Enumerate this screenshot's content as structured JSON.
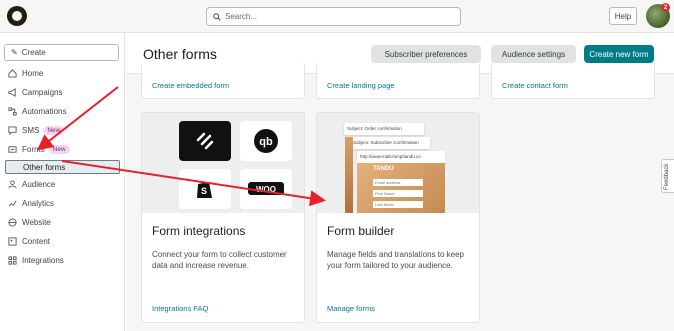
{
  "search": {
    "placeholder": "Search..."
  },
  "topbar": {
    "help_label": "Help",
    "notification_count": "2"
  },
  "sidebar": {
    "create_label": "Create",
    "items": [
      {
        "label": "Home",
        "icon": "home-icon"
      },
      {
        "label": "Campaigns",
        "icon": "megaphone-icon"
      },
      {
        "label": "Automations",
        "icon": "automation-icon"
      },
      {
        "label": "SMS",
        "icon": "sms-icon",
        "tag": "New"
      },
      {
        "label": "Forms",
        "icon": "forms-icon",
        "tag": "New"
      },
      {
        "label": "Audience",
        "icon": "audience-icon"
      },
      {
        "label": "Analytics",
        "icon": "analytics-icon"
      },
      {
        "label": "Website",
        "icon": "website-icon"
      },
      {
        "label": "Content",
        "icon": "content-icon"
      },
      {
        "label": "Integrations",
        "icon": "integrations-icon"
      }
    ],
    "sub_item": "Other forms"
  },
  "header": {
    "title": "Other forms",
    "subscriber_preferences": "Subscriber preferences",
    "audience_settings": "Audience settings",
    "create_new_form": "Create new form"
  },
  "top_links": [
    "Create embedded form",
    "Create landing page",
    "Create contact form"
  ],
  "cards": [
    {
      "title": "Form integrations",
      "description": "Connect your form to collect customer data and increase revenue.",
      "link": "Integrations FAQ"
    },
    {
      "title": "Form builder",
      "description": "Manage fields and translations to keep your form tailored to your audience.",
      "link": "Manage forms"
    }
  ],
  "form_preview": {
    "subject1": "Subject: Order confirmation",
    "subject2": "Subject: Subscriber Confirmation",
    "url": "http://www.mailchimp/tandu.co",
    "brand": "TANDU",
    "fields": [
      "Email address",
      "First Name",
      "Last Name"
    ]
  },
  "feedback_label": "Feedback",
  "colors": {
    "accent": "#007c89",
    "arrow": "#e8202a",
    "tag_bg": "#f5d6ee"
  }
}
